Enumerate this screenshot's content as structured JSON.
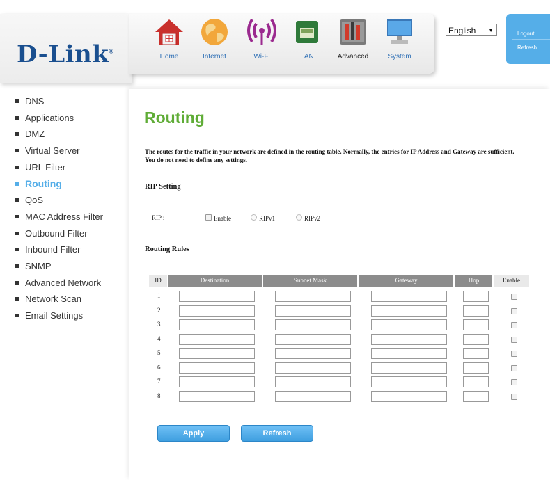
{
  "brand": {
    "logo_text": "D-Link",
    "logo_mark": "®"
  },
  "nav": [
    {
      "label": "Home",
      "icon": "home-icon"
    },
    {
      "label": "Internet",
      "icon": "globe-icon"
    },
    {
      "label": "Wi-Fi",
      "icon": "wifi-icon"
    },
    {
      "label": "LAN",
      "icon": "lan-port-icon"
    },
    {
      "label": "Advanced",
      "icon": "tools-icon",
      "active": true
    },
    {
      "label": "System",
      "icon": "monitor-icon"
    }
  ],
  "language": {
    "selected": "English",
    "arrow": "▼"
  },
  "account": {
    "logout": "Logout",
    "refresh": "Refresh"
  },
  "sidebar": {
    "items": [
      {
        "label": "DNS"
      },
      {
        "label": "Applications"
      },
      {
        "label": "DMZ"
      },
      {
        "label": "Virtual Server"
      },
      {
        "label": "URL Filter"
      },
      {
        "label": "Routing",
        "active": true
      },
      {
        "label": "QoS"
      },
      {
        "label": "MAC Address Filter"
      },
      {
        "label": "Outbound Filter"
      },
      {
        "label": "Inbound Filter"
      },
      {
        "label": "SNMP"
      },
      {
        "label": "Advanced Network"
      },
      {
        "label": "Network Scan"
      },
      {
        "label": "Email Settings"
      }
    ]
  },
  "main": {
    "title": "Routing",
    "intro": "The routes for the traffic in your network are defined in the routing table. Normally, the entries for IP Address and Gateway are sufficient. You do not need to define any settings.",
    "rip": {
      "heading": "RIP Setting",
      "label": "RIP :",
      "enable_label": "Enable",
      "ripv1_label": "RIPv1",
      "ripv2_label": "RIPv2"
    },
    "rules": {
      "heading": "Routing Rules",
      "columns": {
        "id": "ID",
        "destination": "Destination",
        "subnet": "Subnet Mask",
        "gateway": "Gateway",
        "hop": "Hop",
        "enable": "Enable"
      },
      "rows": [
        {
          "id": "1",
          "destination": "",
          "subnet": "",
          "gateway": "",
          "hop": "",
          "enabled": false
        },
        {
          "id": "2",
          "destination": "",
          "subnet": "",
          "gateway": "",
          "hop": "",
          "enabled": false
        },
        {
          "id": "3",
          "destination": "",
          "subnet": "",
          "gateway": "",
          "hop": "",
          "enabled": false
        },
        {
          "id": "4",
          "destination": "",
          "subnet": "",
          "gateway": "",
          "hop": "",
          "enabled": false
        },
        {
          "id": "5",
          "destination": "",
          "subnet": "",
          "gateway": "",
          "hop": "",
          "enabled": false
        },
        {
          "id": "6",
          "destination": "",
          "subnet": "",
          "gateway": "",
          "hop": "",
          "enabled": false
        },
        {
          "id": "7",
          "destination": "",
          "subnet": "",
          "gateway": "",
          "hop": "",
          "enabled": false
        },
        {
          "id": "8",
          "destination": "",
          "subnet": "",
          "gateway": "",
          "hop": "",
          "enabled": false
        }
      ]
    },
    "buttons": {
      "apply": "Apply",
      "refresh": "Refresh"
    }
  },
  "colors": {
    "accent": "#55aee8",
    "title_green": "#5fac36",
    "logo_blue": "#1a4f8f",
    "table_header": "#8c8c8c"
  }
}
